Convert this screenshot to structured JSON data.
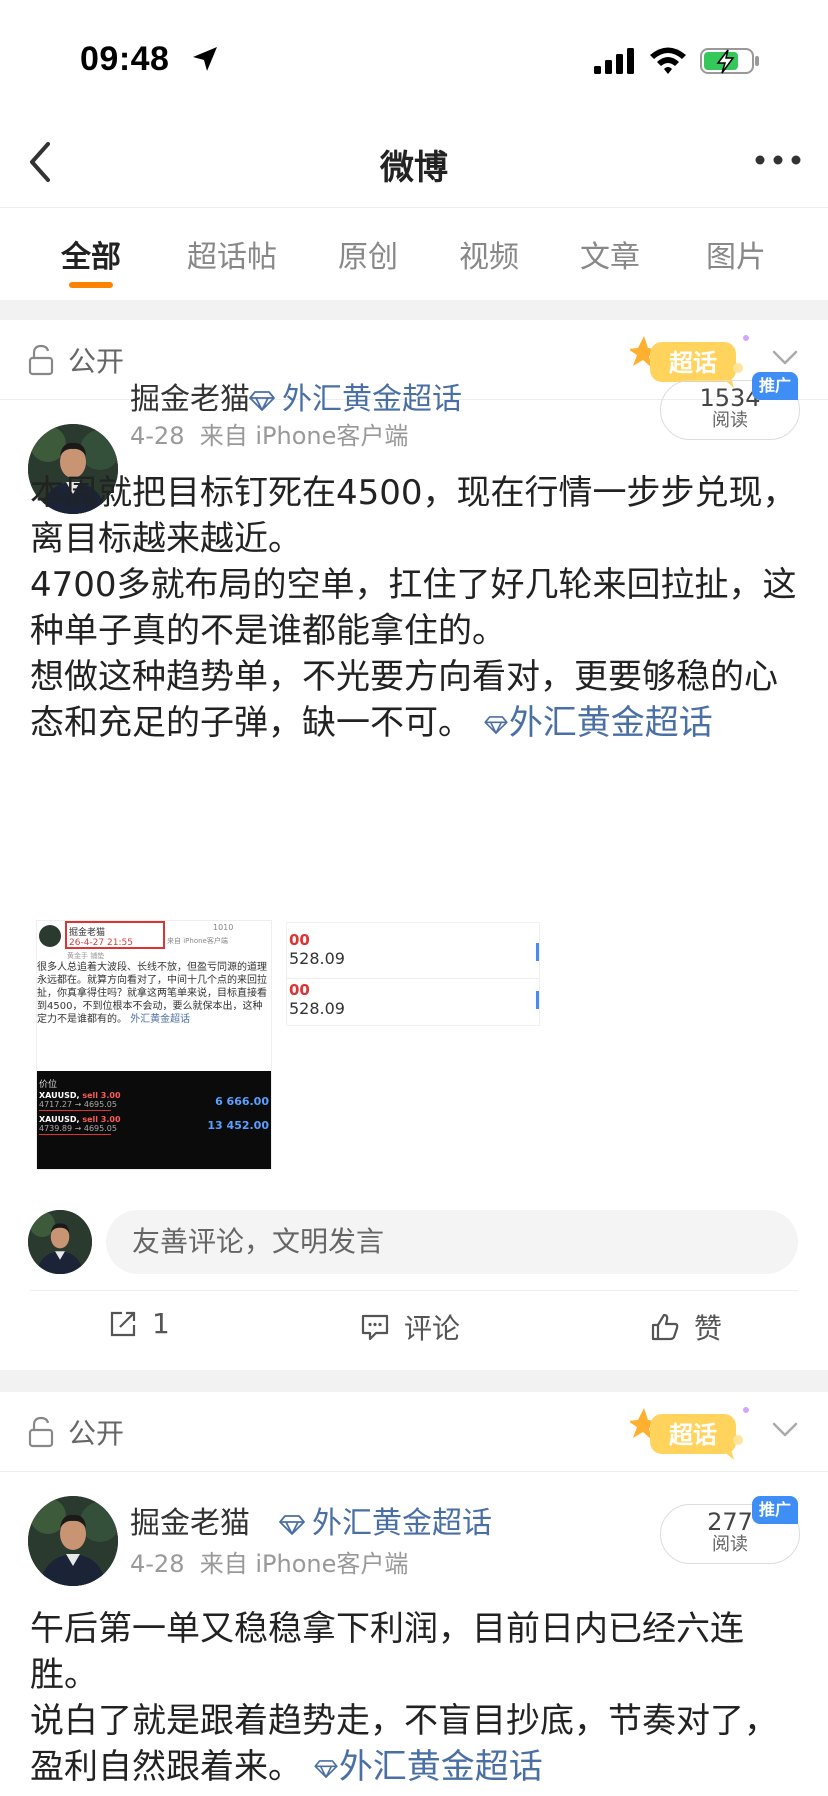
{
  "status_bar": {
    "time": "09:48"
  },
  "nav": {
    "title": "微博"
  },
  "tabs": [
    {
      "label": "全部",
      "active": true
    },
    {
      "label": "超话帖"
    },
    {
      "label": "原创"
    },
    {
      "label": "视频"
    },
    {
      "label": "文章"
    },
    {
      "label": "图片"
    }
  ],
  "posts": [
    {
      "visibility": "公开",
      "badge": "超话",
      "user": "掘金老猫",
      "topic": "外汇黄金超话",
      "date": "4-28",
      "source": "来自 iPhone客户端",
      "reads": "1534",
      "reads_label": "阅读",
      "promo": "推广",
      "body": [
        "本周就把目标钉死在4500，现在行情一步步兑现，离目标越来越近。",
        "4700多就布局的空单，扛住了好几轮来回拉扯，这种单子真的不是谁都能拿住的。",
        "想做这种趋势单，不光要方向看对，更要够稳的心态和充足的子弹，缺一不可。"
      ],
      "body_topic": "外汇黄金超话",
      "thumb_a": {
        "user": "掘金老猫",
        "time": "26-4-27 21:55",
        "source": "来自 iPhone客户端",
        "subline": "黄金手 铺垫",
        "reads": "1010",
        "text": "很多人总追着大波段、长线不放，但盈亏同源的道理永远都在。就算方向看对了，中间十几个点的来回拉扯，你真拿得住吗？就拿这两笔单来说，目标直接看到4500，不到位根本不会动，要么就保本出，这种定力不是谁都有的。",
        "topic": "外汇黄金超话",
        "col_header": "价位",
        "trades": [
          {
            "symbol": "XAUUSD",
            "side": "sell 3.00",
            "route": "4717.27 → 4695.05",
            "pnl": "6 666.00"
          },
          {
            "symbol": "XAUUSD",
            "side": "sell 3.00",
            "route": "4739.89 → 4695.05",
            "pnl": "13 452.00"
          }
        ]
      },
      "thumb_b": {
        "rows": [
          {
            "top": "00",
            "bottom": "528.09"
          },
          {
            "top": "00",
            "bottom": "528.09"
          }
        ]
      },
      "comment_placeholder": "友善评论，文明发言",
      "actions": {
        "share_count": "1",
        "comment": "评论",
        "like": "赞"
      }
    },
    {
      "visibility": "公开",
      "badge": "超话",
      "user": "掘金老猫",
      "topic": "外汇黄金超话",
      "date": "4-28",
      "source": "来自 iPhone客户端",
      "reads": "277",
      "reads_label": "阅读",
      "promo": "推广",
      "body": [
        "午后第一单又稳稳拿下利润，目前日内已经六连胜。",
        "说白了就是跟着趋势走，不盲目抄底，节奏对了，盈利自然跟着来。"
      ],
      "body_topic": "外汇黄金超话"
    }
  ],
  "colors": {
    "accent": "#ff8200",
    "link": "#4a6fa5",
    "promo": "#3f8ef5"
  }
}
